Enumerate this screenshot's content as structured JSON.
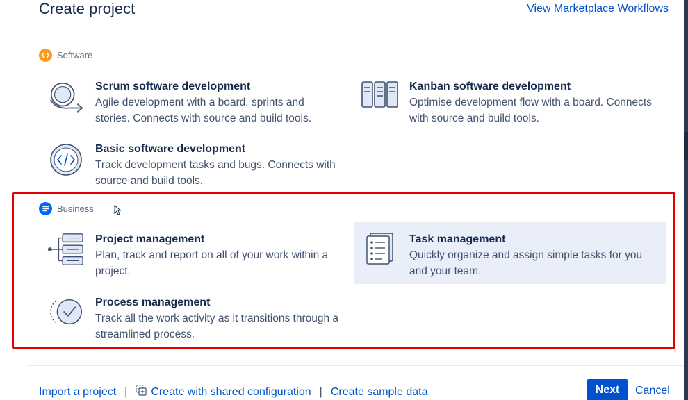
{
  "header": {
    "title": "Create project",
    "marketplace_link": "View Marketplace Workflows"
  },
  "software": {
    "label": "Software",
    "templates": [
      {
        "name": "Scrum software development",
        "description": "Agile development with a board, sprints and stories. Connects with source and build tools."
      },
      {
        "name": "Kanban software development",
        "description": "Optimise development flow with a board. Connects with source and build tools."
      },
      {
        "name": "Basic software development",
        "description": "Track development tasks and bugs. Connects with source and build tools."
      }
    ]
  },
  "business": {
    "label": "Business",
    "templates": [
      {
        "name": "Project management",
        "description": "Plan, track and report on all of your work within a project."
      },
      {
        "name": "Task management",
        "description": "Quickly organize and assign simple tasks for you and your team.",
        "selected": true
      },
      {
        "name": "Process management",
        "description": "Track all the work activity as it transitions through a streamlined process."
      }
    ]
  },
  "footer": {
    "import_link": "Import a project",
    "shared_config_link": "Create with shared configuration",
    "sample_data_link": "Create sample data",
    "next_label": "Next",
    "cancel_label": "Cancel"
  },
  "colors": {
    "primary": "#0052cc",
    "software_badge": "#ff991f",
    "business_badge": "#0065ff",
    "selected_bg": "#e9eef8",
    "highlight_border": "#e60000"
  }
}
